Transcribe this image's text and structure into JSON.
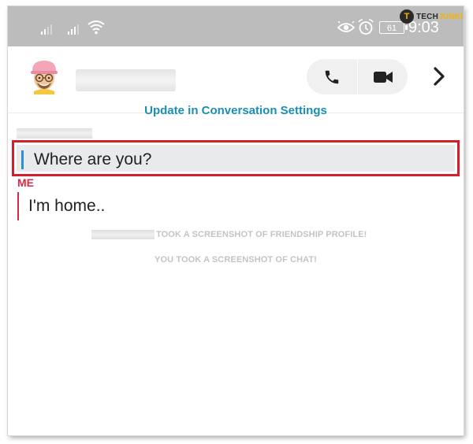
{
  "status_bar": {
    "battery_level": "61",
    "time": "9:03",
    "icons": [
      "signal-icon",
      "signal-icon",
      "wifi-icon",
      "eye-icon",
      "alarm-icon",
      "battery-icon"
    ]
  },
  "watermark": {
    "logo_letter": "T",
    "brand_prefix": "TECH",
    "brand_suffix": "JUNKIE"
  },
  "header": {
    "icons": [
      "avatar",
      "phone-icon",
      "video-icon",
      "chevron-right-icon"
    ]
  },
  "conversation": {
    "update_link": "Update in Conversation Settings",
    "messages": [
      {
        "sender": "",
        "text": "Where are you?",
        "accent": "#2f8fcf"
      },
      {
        "sender": "ME",
        "text": "I'm home..",
        "accent": "#d22c47"
      }
    ],
    "notices": [
      "TOOK A SCREENSHOT OF FRIENDSHIP PROFILE!",
      "YOU TOOK A SCREENSHOT OF CHAT!"
    ]
  },
  "colors": {
    "status_bar": "#bcbcbc",
    "link": "#1a8fb3",
    "highlight_border": "#d21f2b",
    "me_color": "#d22c47"
  }
}
